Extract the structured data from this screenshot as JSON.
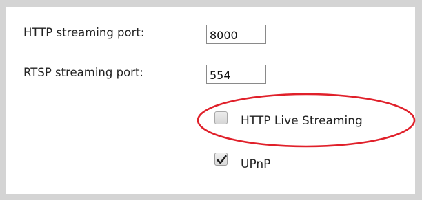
{
  "form": {
    "http_port": {
      "label": "HTTP streaming port:",
      "value": "8000"
    },
    "rtsp_port": {
      "label": "RTSP streaming port:",
      "value": "554"
    },
    "hls": {
      "label": "HTTP Live Streaming",
      "checked": false
    },
    "upnp": {
      "label": "UPnP",
      "checked": true
    }
  },
  "colors": {
    "annotation": "#e0202a",
    "frame": "#d4d4d4"
  }
}
